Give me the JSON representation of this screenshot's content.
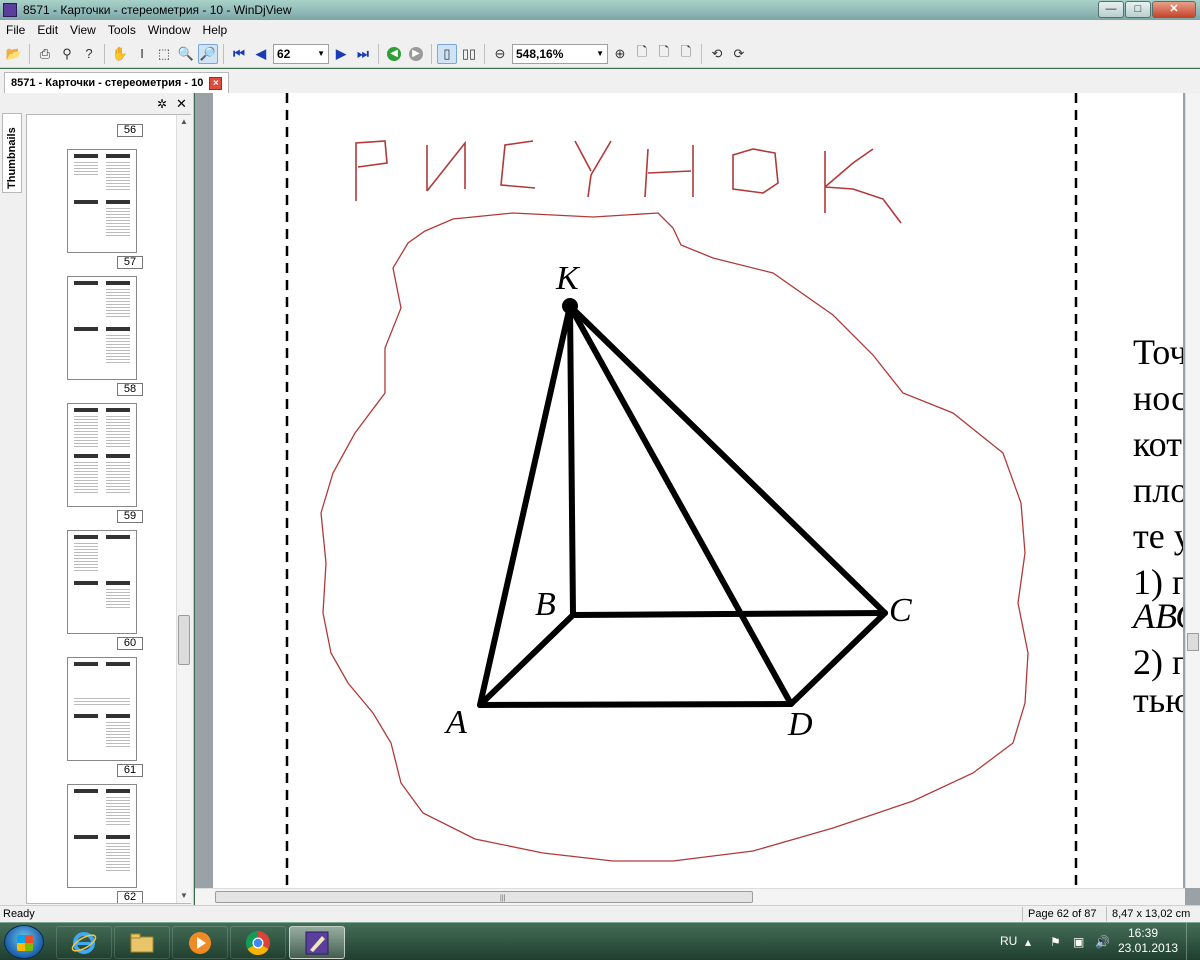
{
  "window": {
    "title": "8571 - Карточки - стереометрия - 10 - WinDjView",
    "controls": {
      "minimize": "—",
      "maximize": "□",
      "close": "✕"
    }
  },
  "menu": [
    "File",
    "Edit",
    "View",
    "Tools",
    "Window",
    "Help"
  ],
  "toolbar": {
    "page_value": "62",
    "zoom_value": "548,16%"
  },
  "tab": {
    "label": "8571 - Карточки - стереометрия - 10",
    "close": "×"
  },
  "sidebar": {
    "tab_label": "Thumbnails",
    "thumbnails": [
      "56",
      "57",
      "58",
      "59",
      "60",
      "61",
      "62"
    ]
  },
  "page": {
    "handwritten_word": "РИСУНОК",
    "figure_labels": {
      "K": "K",
      "A": "A",
      "B": "B",
      "C": "C",
      "D": "D"
    },
    "text_lines": [
      "Точ",
      "нос",
      "кот",
      "пло",
      "те у",
      "1) п",
      "АВС",
      "2) п",
      "тью"
    ]
  },
  "status": {
    "ready": "Ready",
    "page_info": "Page 62 of 87",
    "size_info": "8,47 x 13,02 cm"
  },
  "taskbar": {
    "language": "RU",
    "time": "16:39",
    "date": "23.01.2013"
  }
}
